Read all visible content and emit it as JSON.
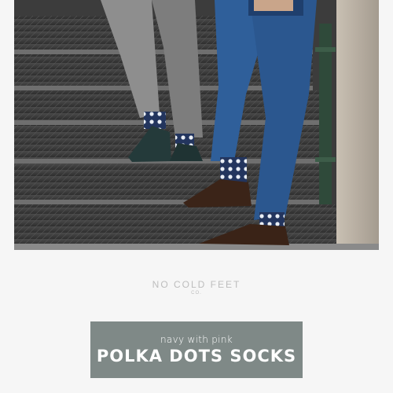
{
  "brand": {
    "name": "NO COLD FEET",
    "suffix": "CO."
  },
  "banner": {
    "subtitle": "navy with pink",
    "title": "POLKA DOTS SOCKS"
  },
  "photo": {
    "subject": "two-men-on-stairs-wearing-polka-dot-socks"
  },
  "colors": {
    "page_background": "#f6f6f6",
    "banner_background": "#7f8987",
    "banner_text": "#ffffff",
    "brand_text": "#bdbdbd"
  }
}
